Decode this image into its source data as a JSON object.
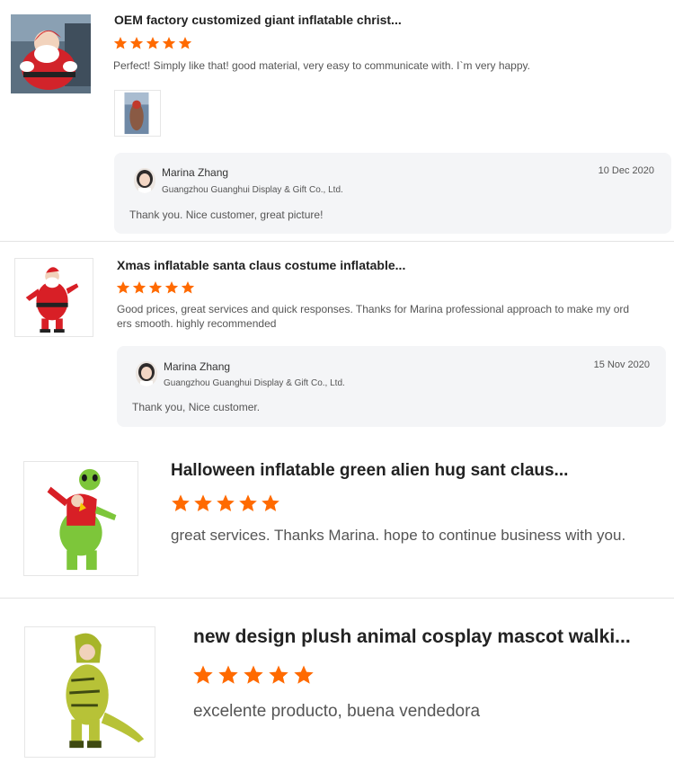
{
  "reviews": [
    {
      "title": "OEM factory customized giant inflatable christ...",
      "rating": 5,
      "text": "Perfect! Simply like that! good material, very easy to communicate with. I`m very happy.",
      "reply": {
        "name": "Marina Zhang",
        "company": "Guangzhou Guanghui Display & Gift Co., Ltd.",
        "date": "10 Dec 2020",
        "text": "Thank you. Nice customer, great picture!"
      }
    },
    {
      "title": "Xmas inflatable santa claus costume inflatable...",
      "rating": 5,
      "text": "Good prices, great services and quick responses. Thanks for Marina professional approach to make my ord ers smooth. highly recommended",
      "reply": {
        "name": "Marina Zhang",
        "company": "Guangzhou Guanghui Display & Gift Co., Ltd.",
        "date": "15 Nov 2020",
        "text": "Thank you, Nice customer."
      }
    },
    {
      "title": "Halloween inflatable green alien hug sant claus...",
      "rating": 5,
      "text": "great services. Thanks Marina. hope to continue business with you."
    },
    {
      "title": "new design plush animal cosplay mascot walki...",
      "rating": 5,
      "text": "excelente producto, buena vendedora"
    }
  ],
  "icons": {
    "star": "star-icon",
    "product_image": "product-image",
    "avatar": "avatar"
  },
  "colors": {
    "star": "#ff6a00",
    "reply_bg": "#f4f5f7"
  }
}
